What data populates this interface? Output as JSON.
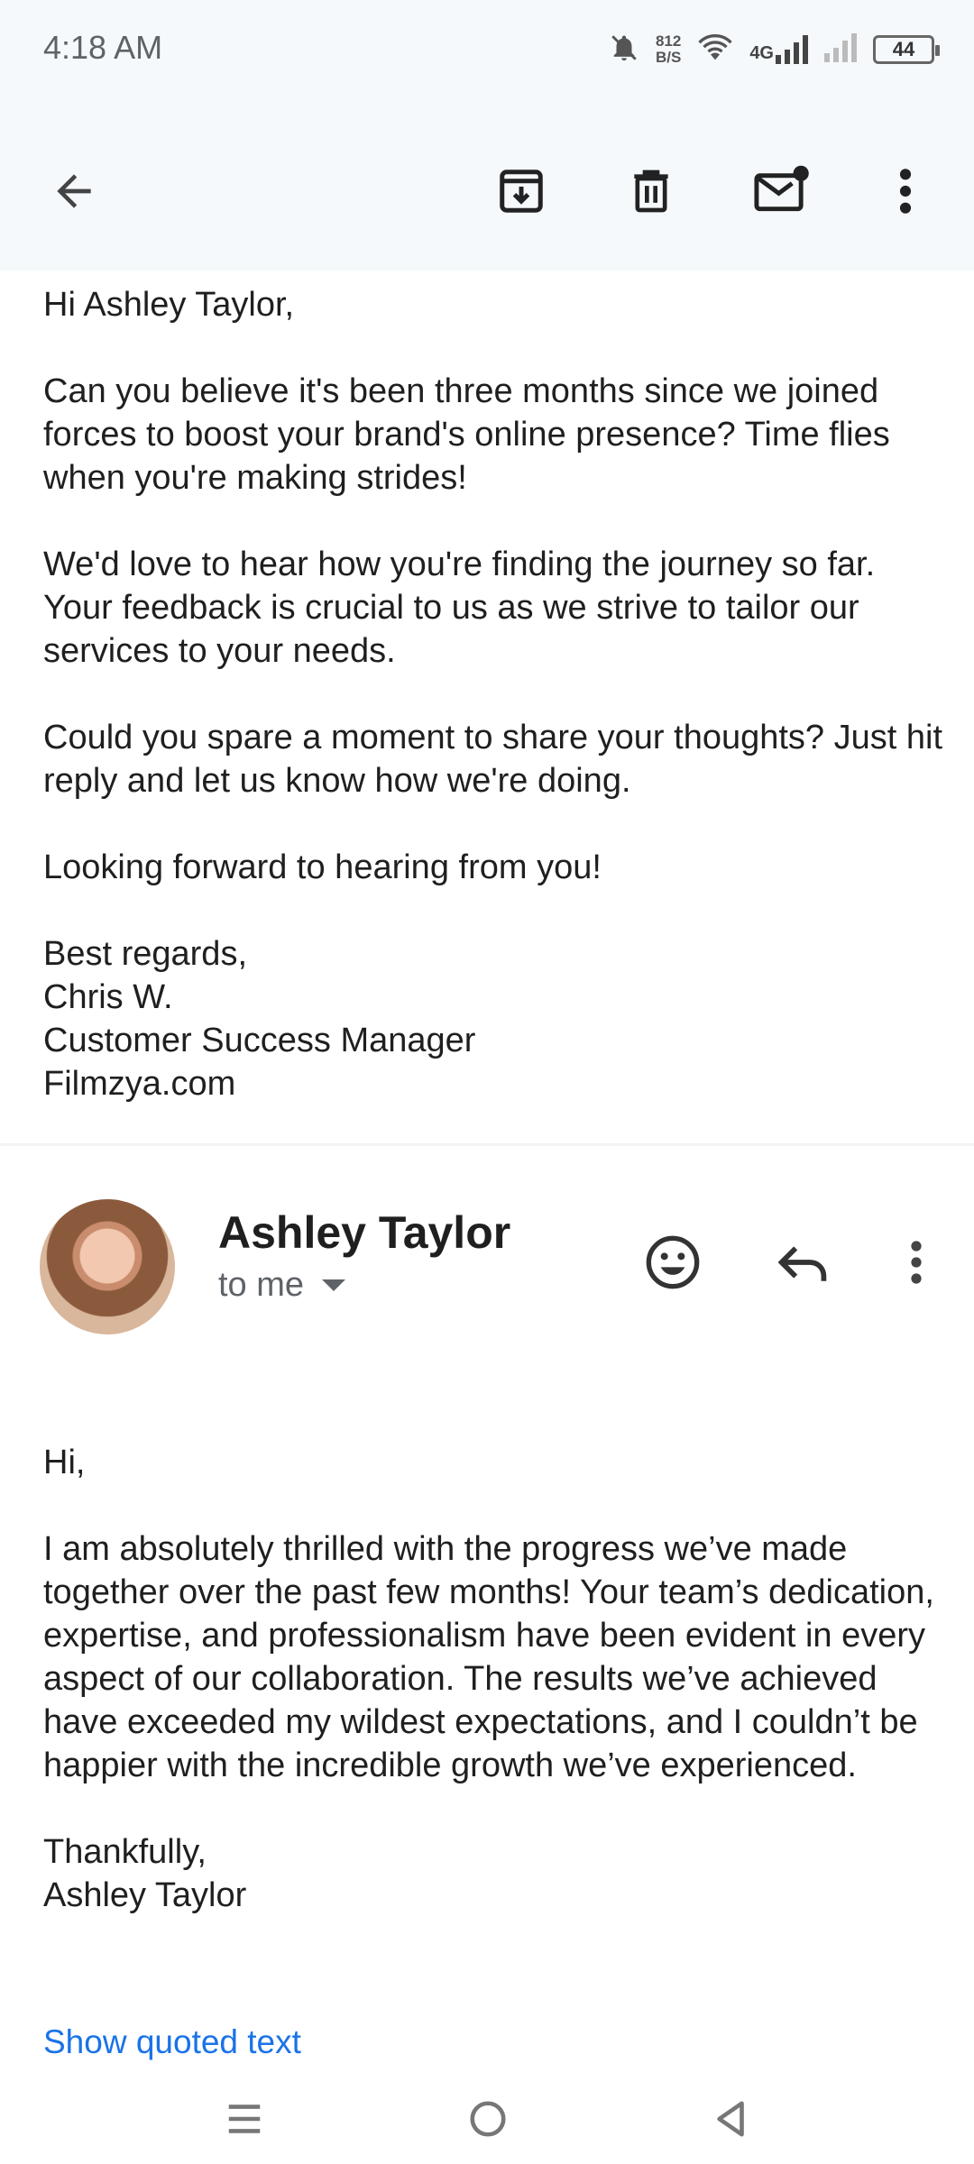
{
  "status_bar": {
    "time": "4:18 AM",
    "net_speed_value": "812",
    "net_speed_unit": "B/S",
    "network_type": "4G",
    "battery": "44"
  },
  "icons": {
    "back": "arrow-back-icon",
    "archive": "archive-icon",
    "delete": "trash-icon",
    "unread": "mark-unread-icon",
    "more": "more-vert-icon",
    "emoji": "emoji-icon",
    "reply": "reply-icon"
  },
  "message1": {
    "greeting": "Hi Ashley Taylor,",
    "para1": "Can you believe it's been three months since we joined forces to boost your brand's online presence? Time flies when you're making strides!",
    "para2": "We'd love to hear how you're finding the journey so far. Your feedback is crucial to us as we strive to tailor our services to your needs.",
    "para3": "Could you spare a moment to share your thoughts? Just hit reply and let us know how we're doing.",
    "para4": "Looking forward to hearing from you!",
    "sign_off": "Best regards,",
    "sig_name": "Chris W.",
    "sig_title": "Customer Success Manager",
    "sig_company": "Filmzya.com"
  },
  "message2": {
    "sender": "Ashley Taylor",
    "recipient": "to me",
    "greeting": "Hi,",
    "para1": "I am absolutely thrilled with the progress we’ve made together over the past few months! Your team’s dedication, expertise, and professionalism have been evident in every aspect of our collaboration. The results we’ve achieved have exceeded my wildest expectations, and I couldn’t be happier with the incredible growth we’ve experienced.",
    "sign_off": "Thankfully,",
    "sig_name": "Ashley Taylor",
    "show_quoted": "Show quoted text"
  },
  "colors": {
    "link": "#1a73e8",
    "header_bg": "#f5f9fc"
  }
}
